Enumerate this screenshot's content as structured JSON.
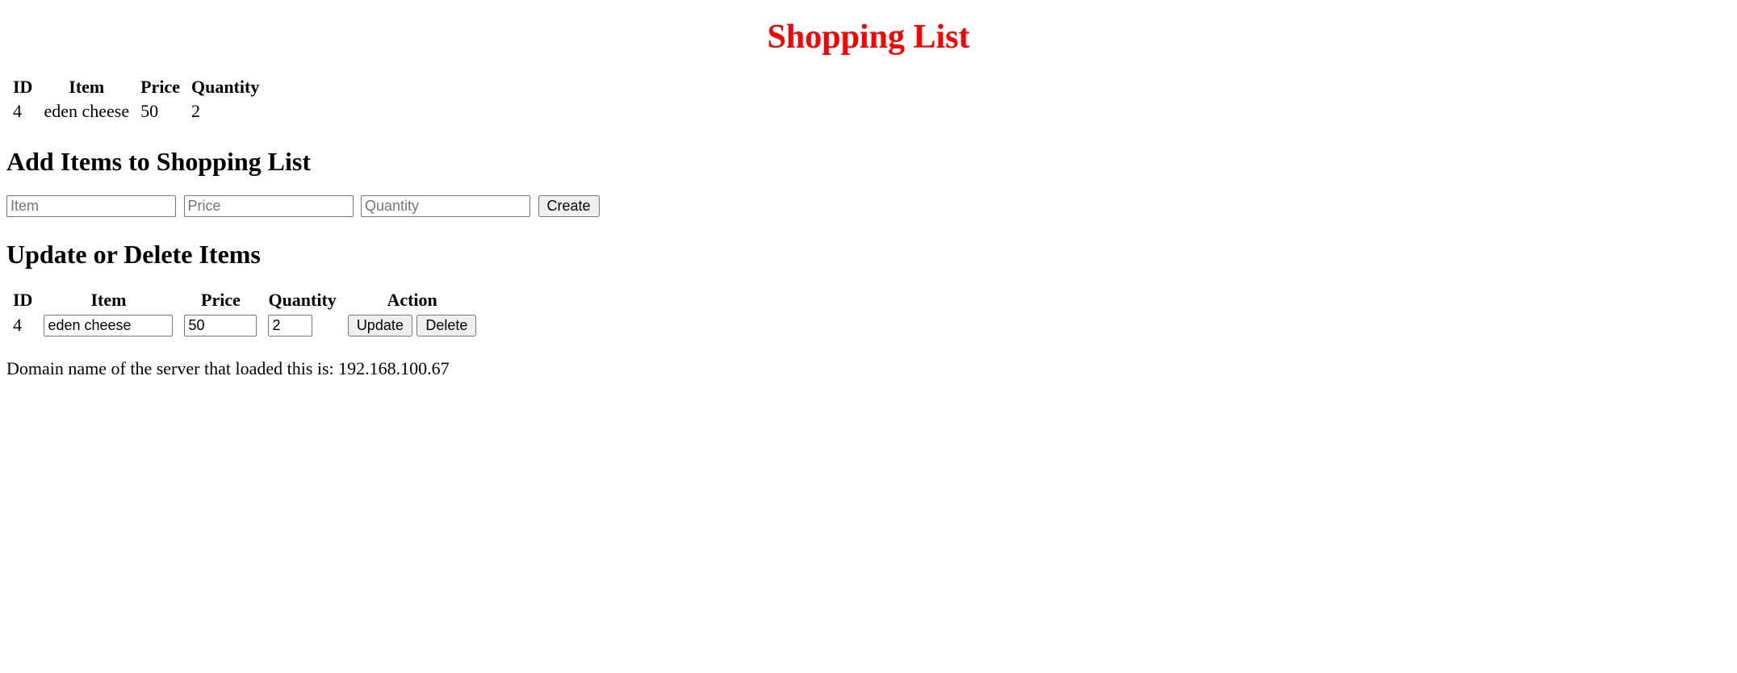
{
  "title": "Shopping List",
  "list_table": {
    "headers": {
      "id": "ID",
      "item": "Item",
      "price": "Price",
      "quantity": "Quantity"
    },
    "rows": [
      {
        "id": "4",
        "item": "eden cheese",
        "price": "50",
        "quantity": "2"
      }
    ]
  },
  "add_section": {
    "heading": "Add Items to Shopping List",
    "placeholders": {
      "item": "Item",
      "price": "Price",
      "quantity": "Quantity"
    },
    "create_label": "Create"
  },
  "edit_section": {
    "heading": "Update or Delete Items",
    "headers": {
      "id": "ID",
      "item": "Item",
      "price": "Price",
      "quantity": "Quantity",
      "action": "Action"
    },
    "rows": [
      {
        "id": "4",
        "item": "eden cheese",
        "price": "50",
        "quantity": "2"
      }
    ],
    "update_label": "Update",
    "delete_label": "Delete"
  },
  "footer": {
    "prefix": "Domain name of the server that loaded this is: ",
    "domain": "192.168.100.67"
  }
}
